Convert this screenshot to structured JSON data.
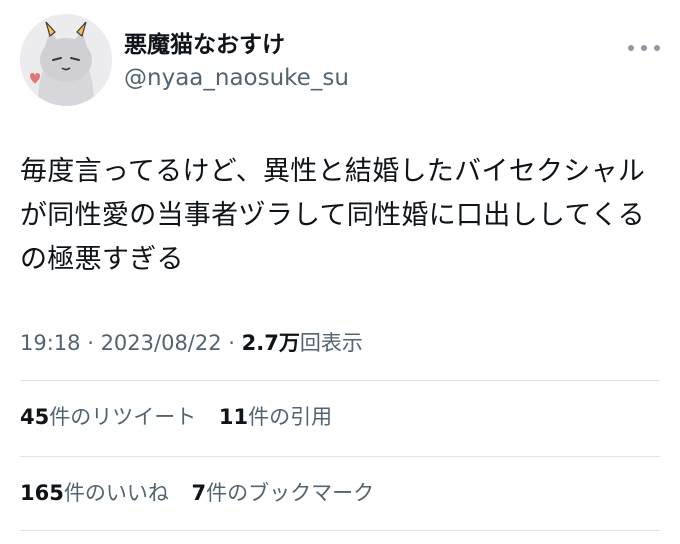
{
  "author": {
    "display_name": "悪魔猫なおすけ",
    "handle": "@nyaa_naosuke_su",
    "avatar_icon": "cat-avatar-icon"
  },
  "more_icon": "ellipsis-icon",
  "tweet": {
    "text": "毎度言ってるけど、異性と結婚したバイセクシャルが同性愛の当事者ヅラして同性婚に口出ししてくるの極悪すぎる"
  },
  "meta": {
    "time": "19:18",
    "sep1": " · ",
    "date": "2023/08/22",
    "sep2": " · ",
    "views_count": "2.7万",
    "views_label": "回表示"
  },
  "stats": {
    "retweets_count": "45",
    "retweets_label": "件のリツイート",
    "quotes_count": "11",
    "quotes_label": "件の引用",
    "likes_count": "165",
    "likes_label": "件のいいね",
    "bookmarks_count": "7",
    "bookmarks_label": "件のブックマーク"
  },
  "colors": {
    "text": "#0f1419",
    "secondary": "#536471",
    "divider": "#dfe3e6"
  }
}
